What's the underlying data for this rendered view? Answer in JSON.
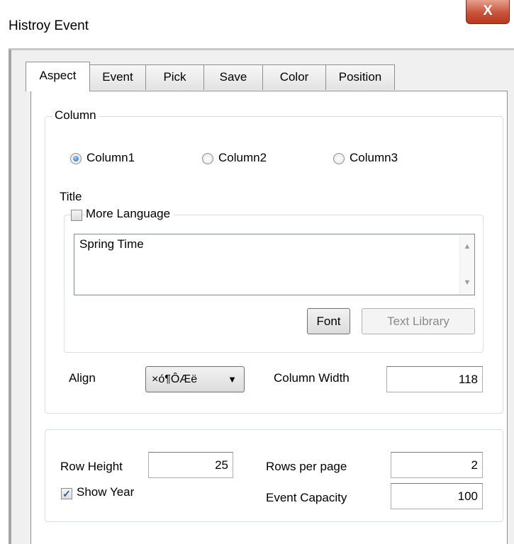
{
  "window": {
    "title": "Histroy Event",
    "close_glyph": "X"
  },
  "tabs": [
    {
      "label": "Aspect"
    },
    {
      "label": "Event"
    },
    {
      "label": "Pick"
    },
    {
      "label": "Save"
    },
    {
      "label": "Color"
    },
    {
      "label": "Position"
    }
  ],
  "active_tab": "Aspect",
  "column_group": {
    "legend": "Column",
    "radios": [
      {
        "label": "Column1",
        "selected": true
      },
      {
        "label": "Column2",
        "selected": false
      },
      {
        "label": "Column3",
        "selected": false
      }
    ],
    "title_label": "Title",
    "more_language": {
      "label": "More Language",
      "checked": false
    },
    "title_text": "Spring Time",
    "font_button": "Font",
    "text_library_button": "Text Library",
    "align_label": "Align",
    "align_value": "×ó¶ÔÆë",
    "column_width_label": "Column Width",
    "column_width_value": "118"
  },
  "row_group": {
    "row_height_label": "Row Height",
    "row_height_value": "25",
    "rows_per_page_label": "Rows per page",
    "rows_per_page_value": "2",
    "show_year": {
      "label": "Show Year",
      "checked": true
    },
    "event_capacity_label": "Event Capacity",
    "event_capacity_value": "100"
  },
  "icons": {
    "close": "close-icon",
    "check": "checkmark-icon",
    "scroll_up": "scroll-up-arrow-icon",
    "scroll_down": "scroll-down-arrow-icon",
    "dropdown": "chevron-down-icon"
  }
}
